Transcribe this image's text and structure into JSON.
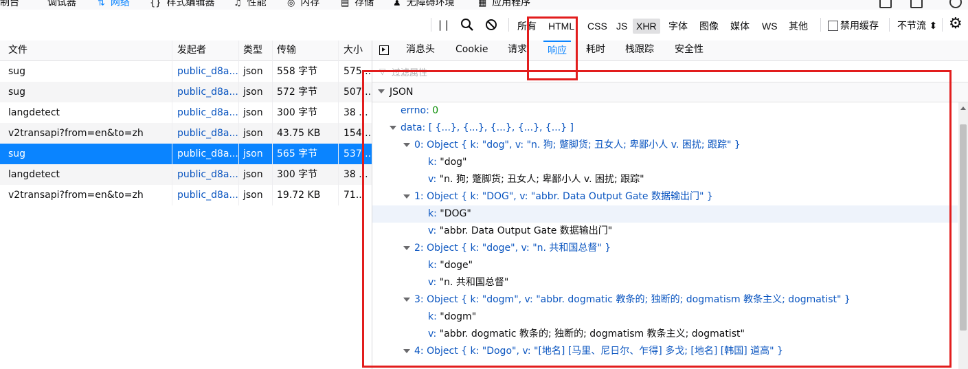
{
  "top_tabs": [
    {
      "icon": "console-icon",
      "label": "制台"
    },
    {
      "icon": "debugger-icon",
      "glyph": "⌒",
      "label": "调试器"
    },
    {
      "icon": "network-icon",
      "glyph": "⇅",
      "label": "网络"
    },
    {
      "icon": "style-editor-icon",
      "glyph": "{}",
      "label": "样式编辑器"
    },
    {
      "icon": "performance-icon",
      "glyph": "♫",
      "label": "性能"
    },
    {
      "icon": "memory-icon",
      "glyph": "◎",
      "label": "内存"
    },
    {
      "icon": "storage-icon",
      "glyph": "▤",
      "label": "存储"
    },
    {
      "icon": "accessibility-icon",
      "glyph": "♟",
      "label": "无障碍环境"
    },
    {
      "icon": "application-icon",
      "glyph": "▦",
      "label": "应用程序"
    }
  ],
  "toolbar": {
    "filter_types": [
      "所有",
      "HTML",
      "CSS",
      "JS",
      "XHR",
      "字体",
      "图像",
      "媒体",
      "WS",
      "其他"
    ],
    "active_type": "XHR",
    "disable_cache_label": "禁用缓存",
    "disable_cache_checked": false,
    "throttle_label": "不节流 ⬍"
  },
  "table": {
    "headers": [
      "文件",
      "发起者",
      "类型",
      "传输",
      "大小"
    ],
    "rows": [
      {
        "file": "sug",
        "initiator": "public_d8a...",
        "type": "json",
        "transfer": "558 字节",
        "size": "575..."
      },
      {
        "file": "sug",
        "initiator": "public_d8a...",
        "type": "json",
        "transfer": "572 字节",
        "size": "507..."
      },
      {
        "file": "langdetect",
        "initiator": "public_d8a...",
        "type": "json",
        "transfer": "300 字节",
        "size": "38 ..."
      },
      {
        "file": "v2transapi?from=en&to=zh",
        "initiator": "public_d8a...",
        "type": "json",
        "transfer": "43.75 KB",
        "size": "154..."
      },
      {
        "file": "sug",
        "initiator": "public_d8a...",
        "type": "json",
        "transfer": "565 字节",
        "size": "537..."
      },
      {
        "file": "langdetect",
        "initiator": "public_d8a...",
        "type": "json",
        "transfer": "300 字节",
        "size": "38 ..."
      },
      {
        "file": "v2transapi?from=en&to=zh",
        "initiator": "public_d8a...",
        "type": "json",
        "transfer": "19.72 KB",
        "size": "71..."
      }
    ],
    "selected_row": 4
  },
  "details": {
    "tabs": [
      "消息头",
      "Cookie",
      "请求",
      "响应",
      "耗时",
      "栈跟踪",
      "安全性"
    ],
    "active_tab": "响应",
    "filter_placeholder": "过滤属性",
    "json_title": "JSON",
    "tree": [
      {
        "indent": 0,
        "twisty": false,
        "key": "errno",
        "sep": ": ",
        "value": "0",
        "kind": "num"
      },
      {
        "indent": 0,
        "twisty": true,
        "key": "data",
        "sep": ": ",
        "value": "[ {...}, {...}, {...}, {...}, {...} ]",
        "kind": "preview"
      },
      {
        "indent": 1,
        "twisty": true,
        "key": "0",
        "sep": ": ",
        "value": "Object { k: \"dog\", v: \"n. 狗; 蹩脚货; 丑女人; 卑鄙小人 v. 困扰; 跟踪\" }",
        "kind": "preview"
      },
      {
        "indent": 2,
        "twisty": false,
        "key": "k",
        "sep": ": ",
        "value": "\"dog\"",
        "kind": "str"
      },
      {
        "indent": 2,
        "twisty": false,
        "key": "v",
        "sep": ": ",
        "value": "\"n. 狗; 蹩脚货; 丑女人; 卑鄙小人 v. 困扰; 跟踪\"",
        "kind": "str"
      },
      {
        "indent": 1,
        "twisty": true,
        "key": "1",
        "sep": ": ",
        "value": "Object { k: \"DOG\", v: \"abbr. Data Output Gate 数据输出门\" }",
        "kind": "preview"
      },
      {
        "indent": 2,
        "twisty": false,
        "key": "k",
        "sep": ": ",
        "value": "\"DOG\"",
        "kind": "str",
        "highlight": true
      },
      {
        "indent": 2,
        "twisty": false,
        "key": "v",
        "sep": ": ",
        "value": "\"abbr. Data Output Gate 数据输出门\"",
        "kind": "str"
      },
      {
        "indent": 1,
        "twisty": true,
        "key": "2",
        "sep": ": ",
        "value": "Object { k: \"doge\", v: \"n. 共和国总督\" }",
        "kind": "preview"
      },
      {
        "indent": 2,
        "twisty": false,
        "key": "k",
        "sep": ": ",
        "value": "\"doge\"",
        "kind": "str"
      },
      {
        "indent": 2,
        "twisty": false,
        "key": "v",
        "sep": ": ",
        "value": "\"n. 共和国总督\"",
        "kind": "str"
      },
      {
        "indent": 1,
        "twisty": true,
        "key": "3",
        "sep": ": ",
        "value": "Object { k: \"dogm\", v: \"abbr. dogmatic 教条的; 独断的; dogmatism 教条主义; dogmatist\" }",
        "kind": "preview"
      },
      {
        "indent": 2,
        "twisty": false,
        "key": "k",
        "sep": ": ",
        "value": "\"dogm\"",
        "kind": "str"
      },
      {
        "indent": 2,
        "twisty": false,
        "key": "v",
        "sep": ": ",
        "value": "\"abbr. dogmatic 教条的; 独断的; dogmatism 教条主义; dogmatist\"",
        "kind": "str"
      },
      {
        "indent": 1,
        "twisty": true,
        "key": "4",
        "sep": ": ",
        "value": "Object { k: \"Dogo\", v: \"[地名] [马里、尼日尔、乍得] 多戈; [地名] [韩国] 道高\" }",
        "kind": "preview"
      }
    ]
  },
  "colors": {
    "accent": "#0a84ff",
    "annotation": "#e21d1d",
    "selected_row": "#0a84ff"
  }
}
